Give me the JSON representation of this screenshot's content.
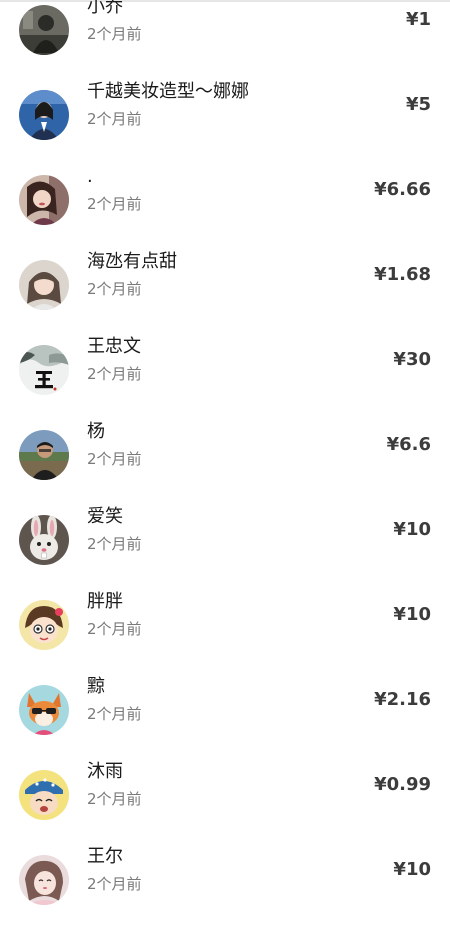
{
  "entries": [
    {
      "name": "小乔",
      "time": "2个月前",
      "amount": "¥1",
      "avatar_icon": "photo-person-icon",
      "avatar_color": "#5b5b55"
    },
    {
      "name": "千越美妆造型～娜娜",
      "time": "2个月前",
      "amount": "¥5",
      "avatar_icon": "photo-woman-blue-icon",
      "avatar_color": "#2f5f9a"
    },
    {
      "name": ".",
      "time": "2个月前",
      "amount": "¥6.66",
      "avatar_icon": "photo-woman-icon",
      "avatar_color": "#c9b2a5"
    },
    {
      "name": "海氹有点甜",
      "time": "2个月前",
      "amount": "¥1.68",
      "avatar_icon": "photo-girl-icon",
      "avatar_color": "#d8d0c8"
    },
    {
      "name": "王忠文",
      "time": "2个月前",
      "amount": "¥30",
      "avatar_icon": "calligraphy-wang-icon",
      "avatar_color": "#e9ecea"
    },
    {
      "name": "杨",
      "time": "2个月前",
      "amount": "¥6.6",
      "avatar_icon": "photo-man-icon",
      "avatar_color": "#6b86a7"
    },
    {
      "name": "爱笑",
      "time": "2个月前",
      "amount": "¥10",
      "avatar_icon": "rabbit-cartoon-icon",
      "avatar_color": "#6a5c54"
    },
    {
      "name": "胖胖",
      "time": "2个月前",
      "amount": "¥10",
      "avatar_icon": "cartoon-girl-icon",
      "avatar_color": "#f3e39a"
    },
    {
      "name": "黥",
      "time": "2个月前",
      "amount": "¥2.16",
      "avatar_icon": "fox-cartoon-icon",
      "avatar_color": "#9fd3dc"
    },
    {
      "name": "沐雨",
      "time": "2个月前",
      "amount": "¥0.99",
      "avatar_icon": "cartoon-boy-hat-icon",
      "avatar_color": "#f1e07a"
    },
    {
      "name": "王尔",
      "time": "2个月前",
      "amount": "¥10",
      "avatar_icon": "photo-girl-pink-icon",
      "avatar_color": "#e8d6d8"
    }
  ]
}
